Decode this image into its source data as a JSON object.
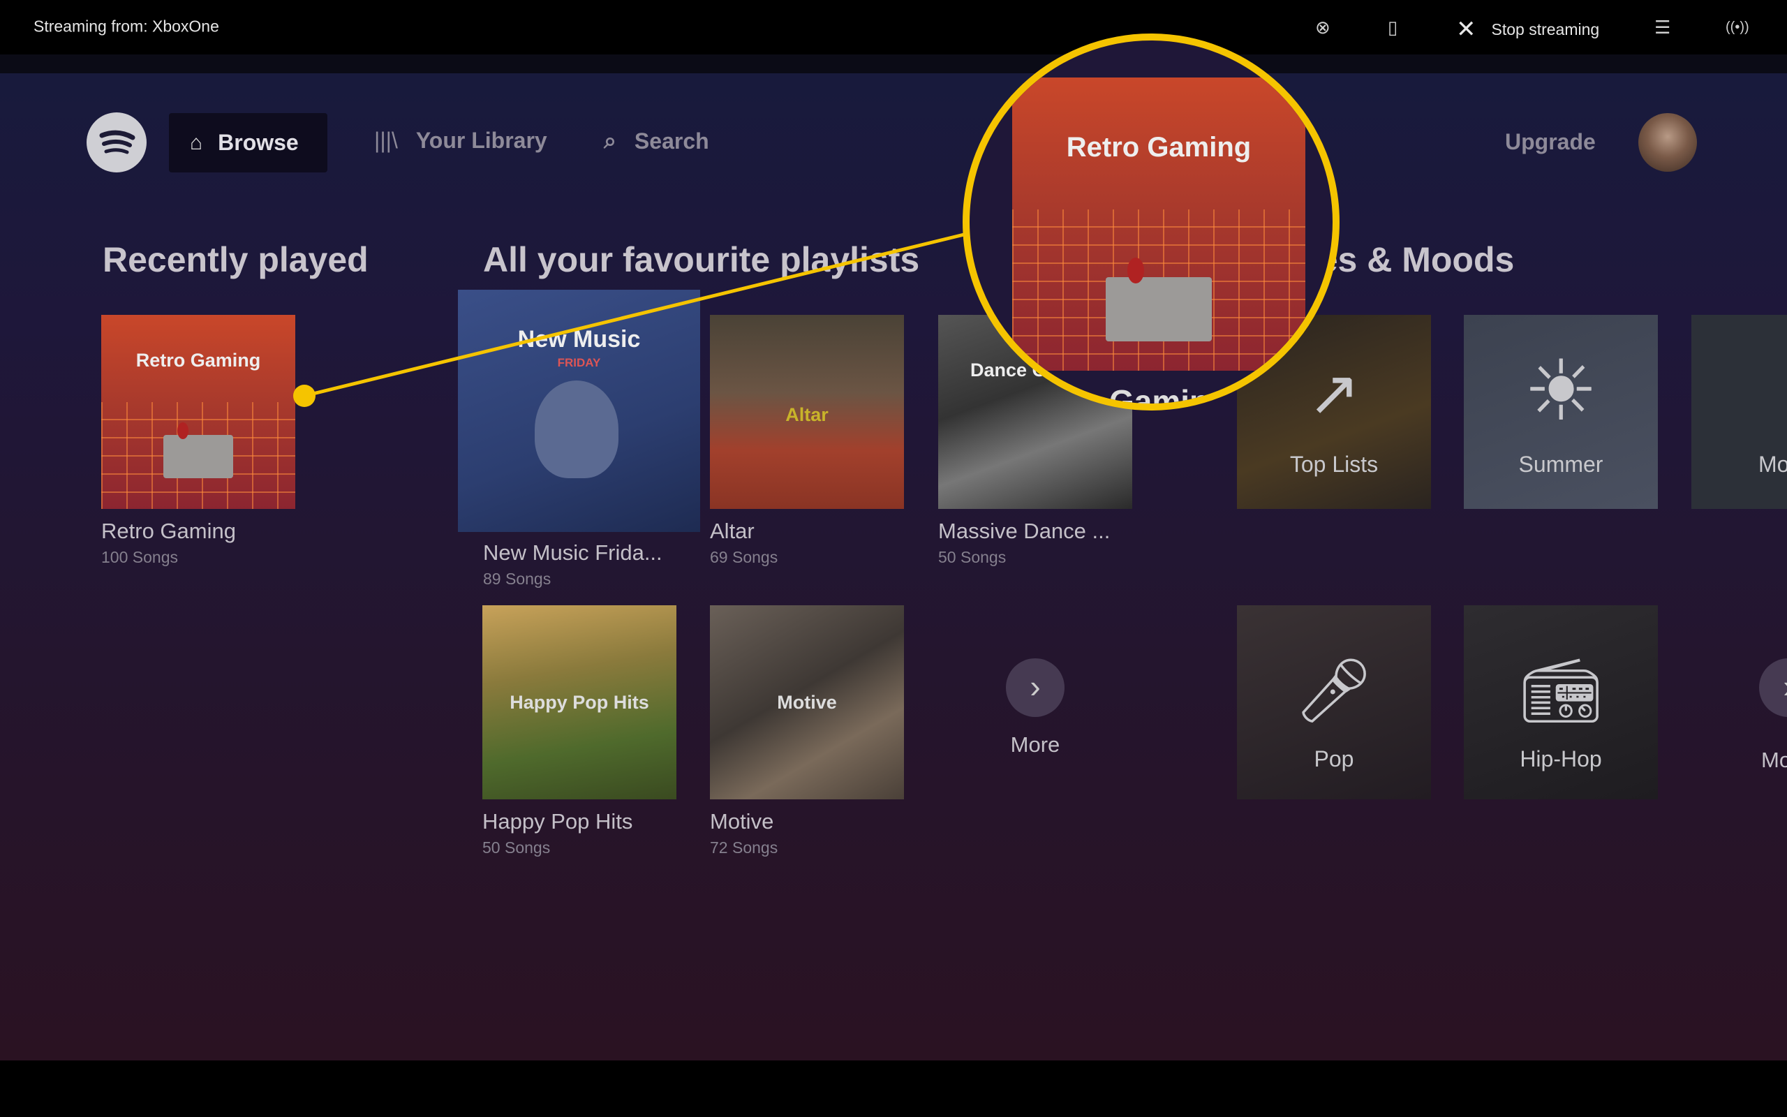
{
  "system_bar": {
    "streaming_label": "Streaming from: XboxOne",
    "stop_label": "Stop streaming",
    "icons": [
      "xbox-icon",
      "phone-mic-icon",
      "close-icon",
      "list-icon",
      "broadcast-icon"
    ]
  },
  "nav": {
    "browse": "Browse",
    "library": "Your Library",
    "search": "Search",
    "upgrade": "Upgrade"
  },
  "sections": {
    "recent": {
      "heading": "Recently played",
      "items": [
        {
          "title": "Retro Gaming",
          "sub": "100 Songs",
          "art": "Retro Gaming"
        }
      ]
    },
    "playlists": {
      "heading": "All your favourite playlists",
      "items": [
        {
          "title": "New Music Frida...",
          "sub": "89 Songs",
          "art": "New Music",
          "art2": "FRIDAY"
        },
        {
          "title": "Altar",
          "sub": "69 Songs",
          "art": "Altar"
        },
        {
          "title": "Massive Dance ...",
          "sub": "50 Songs",
          "art": "Dance C"
        },
        {
          "title": "Happy Pop Hits",
          "sub": "50 Songs",
          "art": "Happy Pop Hits"
        },
        {
          "title": "Motive",
          "sub": "72 Songs",
          "art": "Motive"
        }
      ],
      "more": "More"
    },
    "genres": {
      "heading": "Genres & Moods",
      "items": [
        "Top Lists",
        "Summer",
        "Mo",
        "Pop",
        "Hip-Hop"
      ],
      "more": "Mo"
    }
  },
  "magnifier": {
    "title": "Retro Gaming",
    "below": "Gamin",
    "color": "#f5c400"
  },
  "colors": {
    "accent": "#f5c400"
  }
}
